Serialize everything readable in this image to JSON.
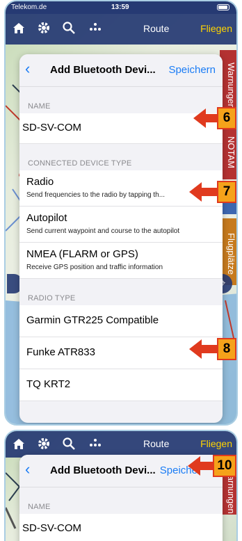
{
  "statusbar": {
    "carrier": "Telekom.de",
    "time": "13:59"
  },
  "toolbar": {
    "route_label": "Route",
    "fly_label": "Fliegen"
  },
  "side_tabs": {
    "warnings": "Warnungen",
    "notam": "NOTAM",
    "airfields": "Flugplätze"
  },
  "modal": {
    "title": "Add Bluetooth Devi...",
    "save_label": "Speichern",
    "name_header": "NAME",
    "name_value": "SD-SV-COM",
    "device_type_header": "CONNECTED DEVICE TYPE",
    "device_types": [
      {
        "label": "Radio",
        "description": "Send frequencies to the radio by tapping th..."
      },
      {
        "label": "Autopilot",
        "description": "Send current waypoint and course to the autopilot"
      },
      {
        "label": "NMEA (FLARM or GPS)",
        "description": "Receive GPS position and traffic information"
      }
    ],
    "radio_type_header": "RADIO TYPE",
    "radio_types": [
      "Garmin GTR225 Compatible",
      "Funke ATR833",
      "TQ KRT2"
    ]
  },
  "modal2": {
    "title": "Add Bluetooth Devi...",
    "save_label": "Speiche",
    "name_header": "NAME",
    "name_value": "SD-SV-COM"
  },
  "callouts": {
    "c6": "6",
    "c7": "7",
    "c8": "8",
    "c10": "10"
  },
  "colors": {
    "toolbar": "#263a73",
    "accent": "#1a7cf5",
    "fly": "#ffd400",
    "callout_red": "#e03a1e",
    "callout_fill": "#f5a21a"
  },
  "icons": [
    "home-icon",
    "gear-icon",
    "search-icon",
    "more-dots-icon",
    "back-chevron-icon",
    "locate-icon"
  ]
}
